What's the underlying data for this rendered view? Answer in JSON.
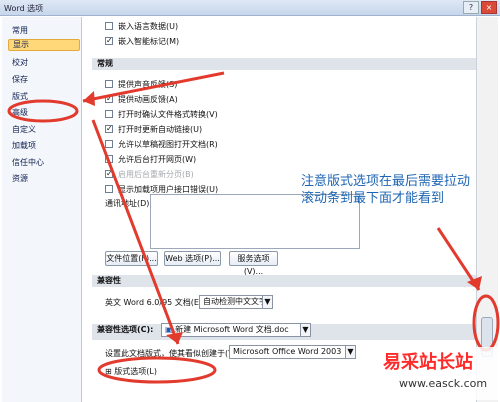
{
  "window": {
    "title": "Word 选项",
    "help": "?",
    "close": "×"
  },
  "sidebar": [
    "常用",
    "显示",
    "校对",
    "保存",
    "版式",
    "高级",
    "自定义",
    "加载项",
    "信任中心",
    "资源"
  ],
  "options": {
    "top": [
      "嵌入语言数据(U)",
      "嵌入智能标记(M)"
    ],
    "general_title": "常规",
    "general": [
      "提供声音反馈(S)",
      "提供动画反馈(A)",
      "打开时确认文件格式转换(V)",
      "打开时更新自动链接(U)",
      "允许以草稿视图打开文档(R)",
      "允许后台打开网页(W)",
      "启用后台重新分页(B)",
      "显示加载项用户接口错误(U)"
    ],
    "mailing_label": "通讯地址(D):"
  },
  "buttons": [
    "文件位置(F)...",
    "Web 选项(P)...",
    "服务选项(V)..."
  ],
  "compatibility": {
    "title": "兼容性",
    "english_label": "英文 Word 6.0/95 文档(E):",
    "english_value": "自动检测中文文字"
  },
  "compat_options": {
    "title": "兼容性选项(C):",
    "doc_value": "新建 Microsoft Word 文档.doc",
    "layout_label": "设置此文档版式，使其看似创建于(Y):",
    "layout_value": "Microsoft Office Word 2003",
    "layout_options": "版式选项(L)"
  },
  "annotation": "注意版式选项在最后需要拉动滚动条到最下面才能看到",
  "annotation_lines": [
    "注意版式选项在最后需要拉动",
    "滚动条到最下面才能看到"
  ],
  "watermark": {
    "brand": "易采站长站",
    "url": "www.easck.com"
  },
  "colors": {
    "annotation": "#1e65b3",
    "highlight": "#ffd879",
    "mark": "#e23a2d"
  }
}
